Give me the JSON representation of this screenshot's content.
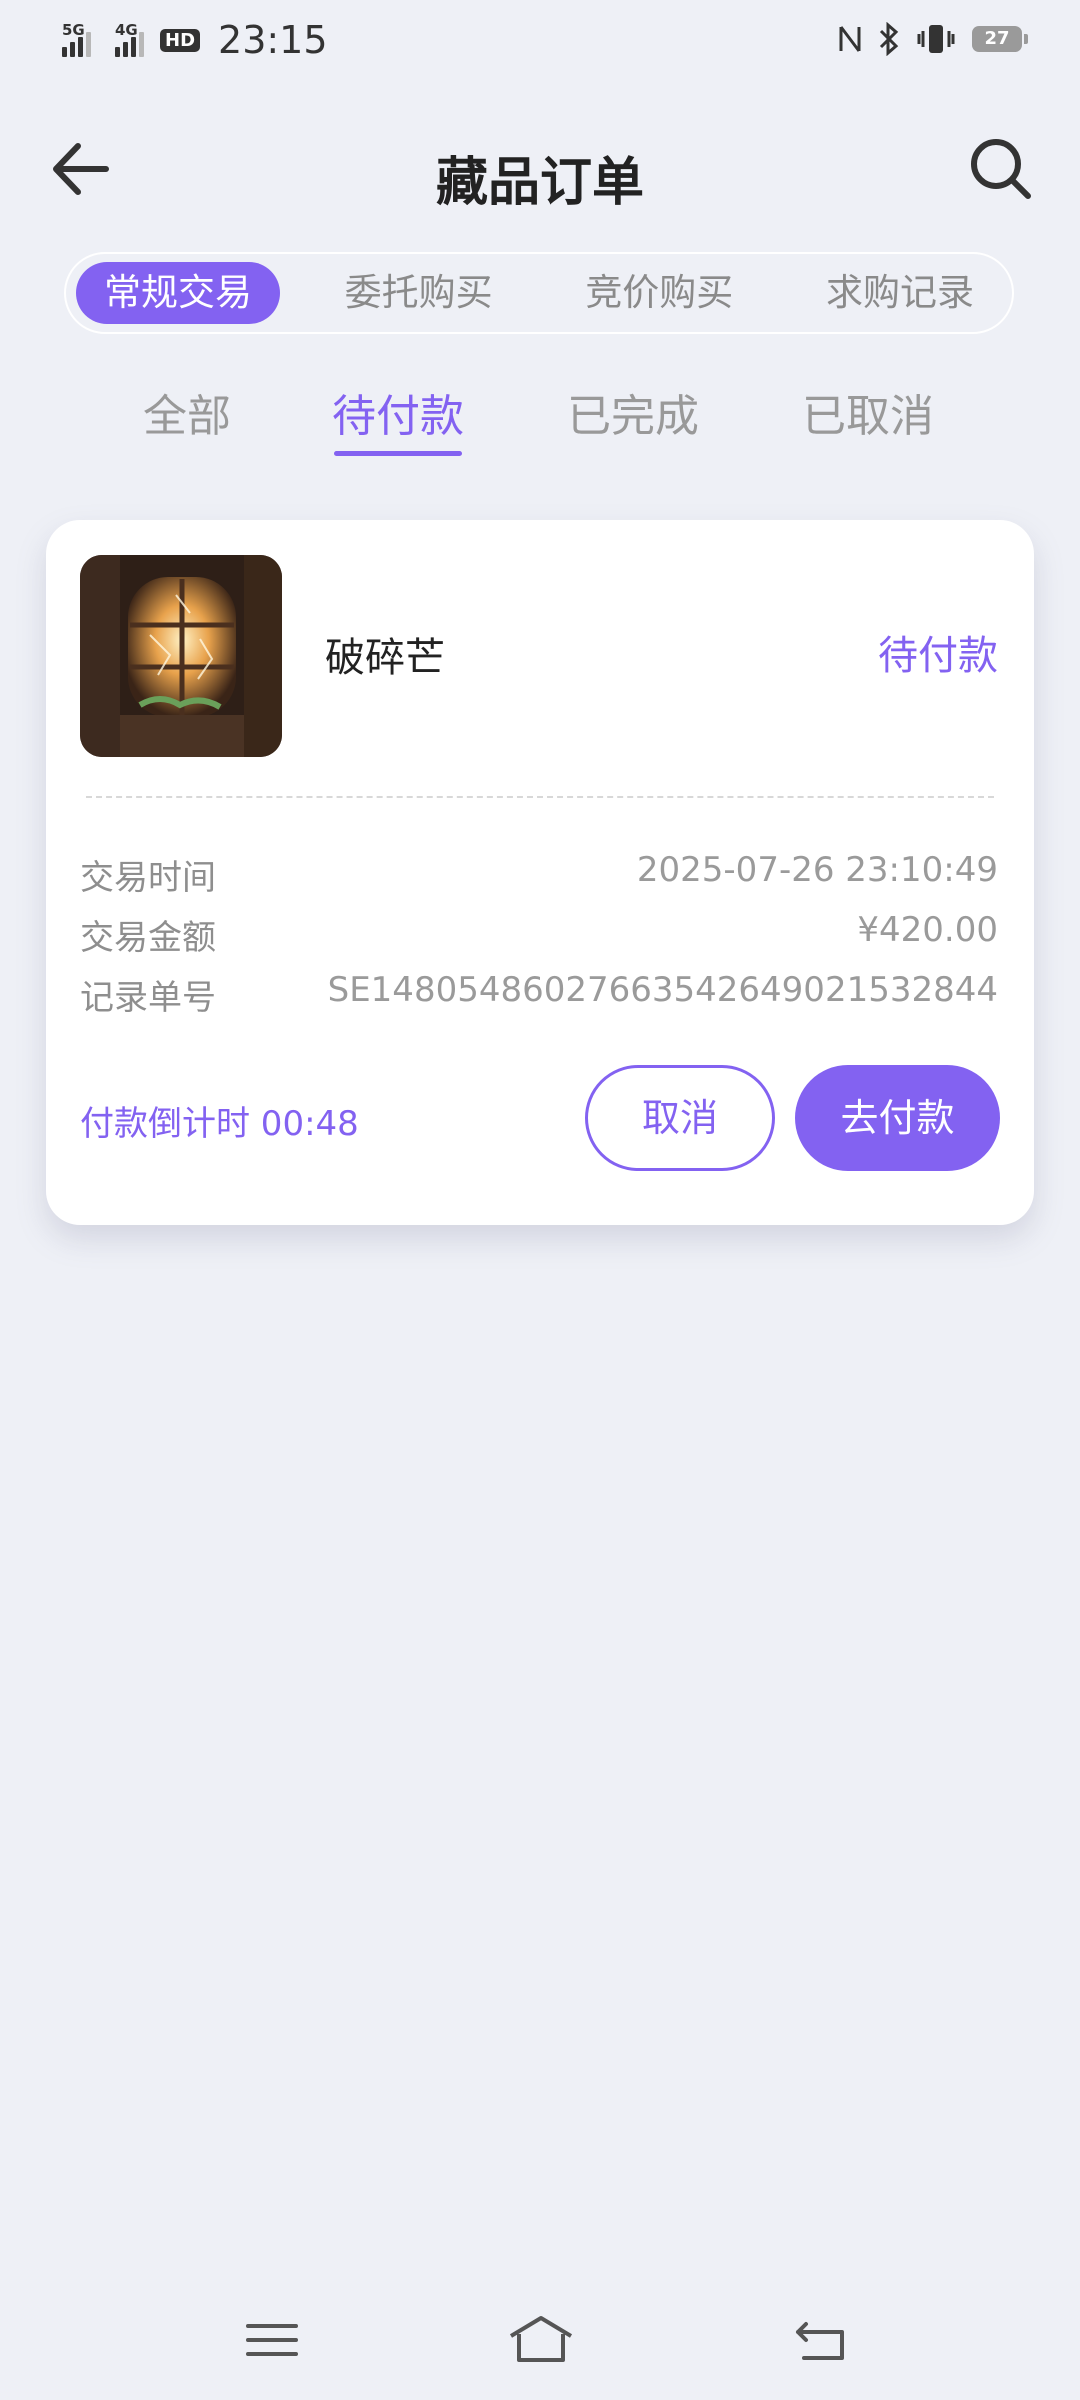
{
  "status_bar": {
    "net1": "5G",
    "net2": "4G",
    "hd": "HD",
    "time": "23:15",
    "battery": "27"
  },
  "header": {
    "title": "藏品订单"
  },
  "segments": [
    "常规交易",
    "委托购买",
    "竞价购买",
    "求购记录"
  ],
  "tabs": [
    "全部",
    "待付款",
    "已完成",
    "已取消"
  ],
  "order": {
    "name": "破碎芒",
    "status": "待付款",
    "rows": [
      {
        "label": "交易时间",
        "value": "2025-07-26 23:10:49"
      },
      {
        "label": "交易金额",
        "value": "¥420.00"
      },
      {
        "label": "记录单号",
        "value": "SE14805486027663542649021532844"
      }
    ],
    "countdown": "付款倒计时 00:48",
    "cancel_label": "取消",
    "pay_label": "去付款"
  },
  "colors": {
    "accent": "#8362f1",
    "background": "#eef0f6"
  }
}
